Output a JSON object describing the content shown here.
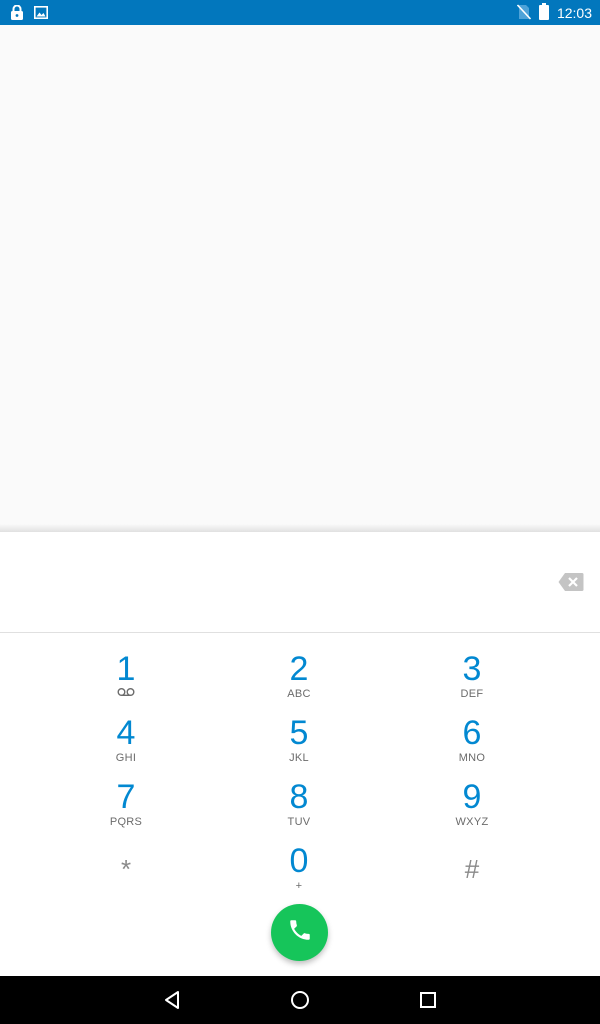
{
  "status_bar": {
    "time": "12:03",
    "icons": [
      "lock-icon",
      "image-notification-icon",
      "no-sim-icon",
      "battery-icon"
    ]
  },
  "dialer": {
    "digits_value": "",
    "backspace_icon": "backspace-icon",
    "keys": [
      {
        "num": "1",
        "letters": "",
        "sub_icon": "voicemail-icon"
      },
      {
        "num": "2",
        "letters": "ABC"
      },
      {
        "num": "3",
        "letters": "DEF"
      },
      {
        "num": "4",
        "letters": "GHI"
      },
      {
        "num": "5",
        "letters": "JKL"
      },
      {
        "num": "6",
        "letters": "MNO"
      },
      {
        "num": "7",
        "letters": "PQRS"
      },
      {
        "num": "8",
        "letters": "TUV"
      },
      {
        "num": "9",
        "letters": "WXYZ"
      },
      {
        "num": "*",
        "letters": ""
      },
      {
        "num": "0",
        "letters": "+"
      },
      {
        "num": "#",
        "letters": ""
      }
    ],
    "call_icon": "phone-icon"
  },
  "nav_bar": {
    "icons": [
      "back-icon",
      "home-icon",
      "recents-icon"
    ]
  },
  "colors": {
    "status_bar": "#0277bd",
    "digit_accent": "#0288d1",
    "call_button": "#16c55a"
  }
}
